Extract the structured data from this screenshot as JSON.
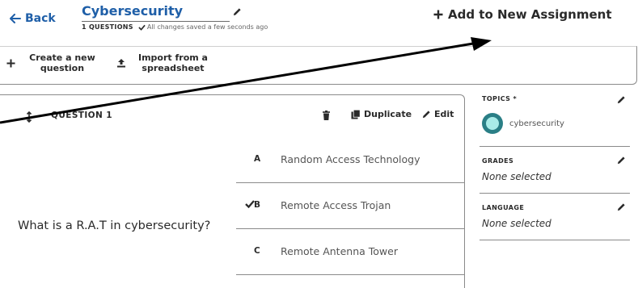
{
  "header": {
    "back_label": "Back",
    "title": "Cybersecurity",
    "question_count": "1 QUESTIONS",
    "save_status": "All changes saved a few seconds ago",
    "add_assignment_label": "Add to New Assignment"
  },
  "toolbar": {
    "create_label": "Create a new question",
    "import_label": "Import from a spreadsheet"
  },
  "question": {
    "label": "QUESTION 1",
    "delete_icon": "trash-icon",
    "duplicate_label": "Duplicate",
    "edit_label": "Edit",
    "text": "What is a R.A.T in cybersecurity?",
    "answers": [
      {
        "letter": "A",
        "text": "Random Access Technology",
        "correct": false
      },
      {
        "letter": "B",
        "text": "Remote Access Trojan",
        "correct": true
      },
      {
        "letter": "C",
        "text": "Remote Antenna Tower",
        "correct": false
      }
    ]
  },
  "side": {
    "topics_label": "TOPICS *",
    "topic_name": "cybersecurity",
    "grades_label": "GRADES",
    "grades_value": "None selected",
    "language_label": "LANGUAGE",
    "language_value": "None selected"
  },
  "colors": {
    "link": "#1f5fa8",
    "topic_avatar": "#2a7f86",
    "topic_avatar_inner": "#a9ece8"
  }
}
